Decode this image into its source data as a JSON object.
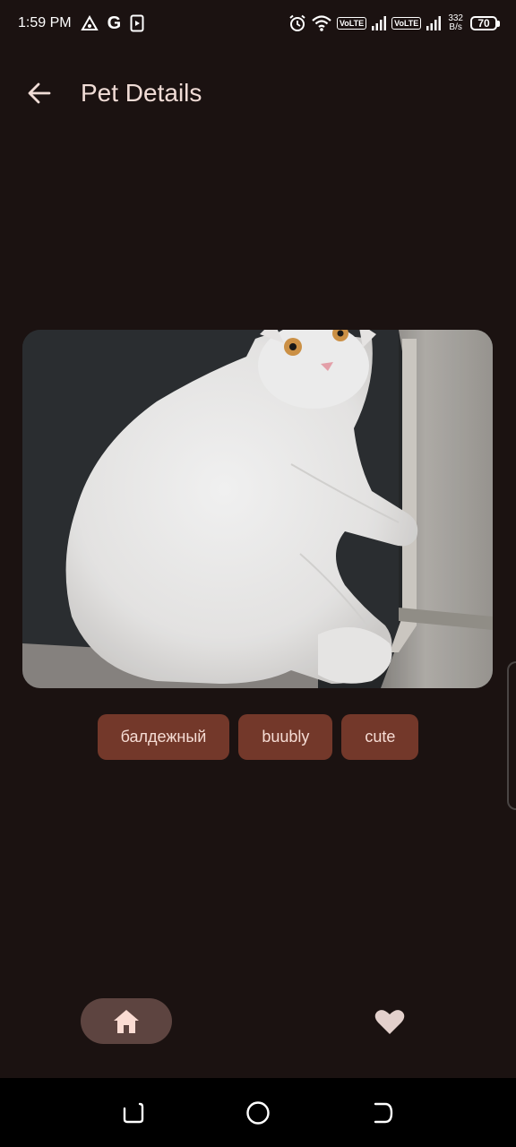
{
  "status_bar": {
    "time": "1:59 PM",
    "g_letter": "G",
    "volte_1": "VoLTE",
    "volte_2": "VoLTE",
    "net_speed_value": "332",
    "net_speed_unit": "B/s",
    "battery": "70",
    "icons": [
      "triangle-icon",
      "google-icon",
      "media-icon",
      "alarm-icon",
      "wifi-icon",
      "signal-icon",
      "battery-icon"
    ]
  },
  "top_bar": {
    "title": "Pet Details",
    "back_icon": "arrow-back-icon"
  },
  "pet": {
    "image": "white-cat-photo",
    "tags": [
      "балдежный",
      "buubly",
      "cute"
    ]
  },
  "bottom_nav": {
    "home_icon": "home-icon",
    "favorites_icon": "heart-icon",
    "selected": "home"
  },
  "system_nav": {
    "icons": [
      "recents-icon",
      "home-circle-icon",
      "back-icon"
    ]
  },
  "colors": {
    "background": "#1b1211",
    "tag_chip": "#73382a",
    "tag_text": "#f6dcd4",
    "nav_selected_pill": "#5d4440",
    "title_text": "#f0dcd6"
  }
}
